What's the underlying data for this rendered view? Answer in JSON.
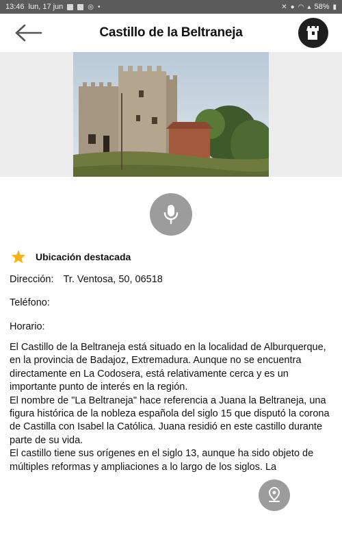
{
  "status_bar": {
    "time": "13:46",
    "date": "lun, 17 jun",
    "battery": "58%"
  },
  "header": {
    "title": "Castillo de la Beltraneja",
    "back_icon": "arrow-left-icon",
    "action_icon": "castle-tower-icon"
  },
  "photo": {
    "alt": "Castillo de la Beltraneja"
  },
  "audio": {
    "icon": "microphone-icon"
  },
  "featured": {
    "icon": "star-icon",
    "color": "#f2b31c",
    "label": "Ubicación destacada"
  },
  "details": {
    "address_label": "Dirección:",
    "address_value": "Tr. Ventosa, 50, 06518",
    "phone_label": "Teléfono:",
    "hours_label": "Horario:"
  },
  "description": {
    "paragraphs": [
      "El Castillo de la Beltraneja está situado en la localidad de Alburquerque, en la provincia de Badajoz, Extremadura. Aunque no se encuentra directamente en La Codosera, está relativamente cerca y es un importante punto de interés en la región.",
      "El nombre de \"La Beltraneja\" hace referencia a Juana la Beltraneja, una figura histórica de la nobleza española del siglo 15 que disputó la corona de Castilla con Isabel la Católica. Juana residió en este castillo durante parte de su vida.",
      "El castillo tiene sus orígenes en el siglo 13, aunque ha sido objeto de múltiples reformas y ampliaciones a lo largo de los siglos. La"
    ]
  },
  "map_button": {
    "icon": "location-pin-icon"
  }
}
